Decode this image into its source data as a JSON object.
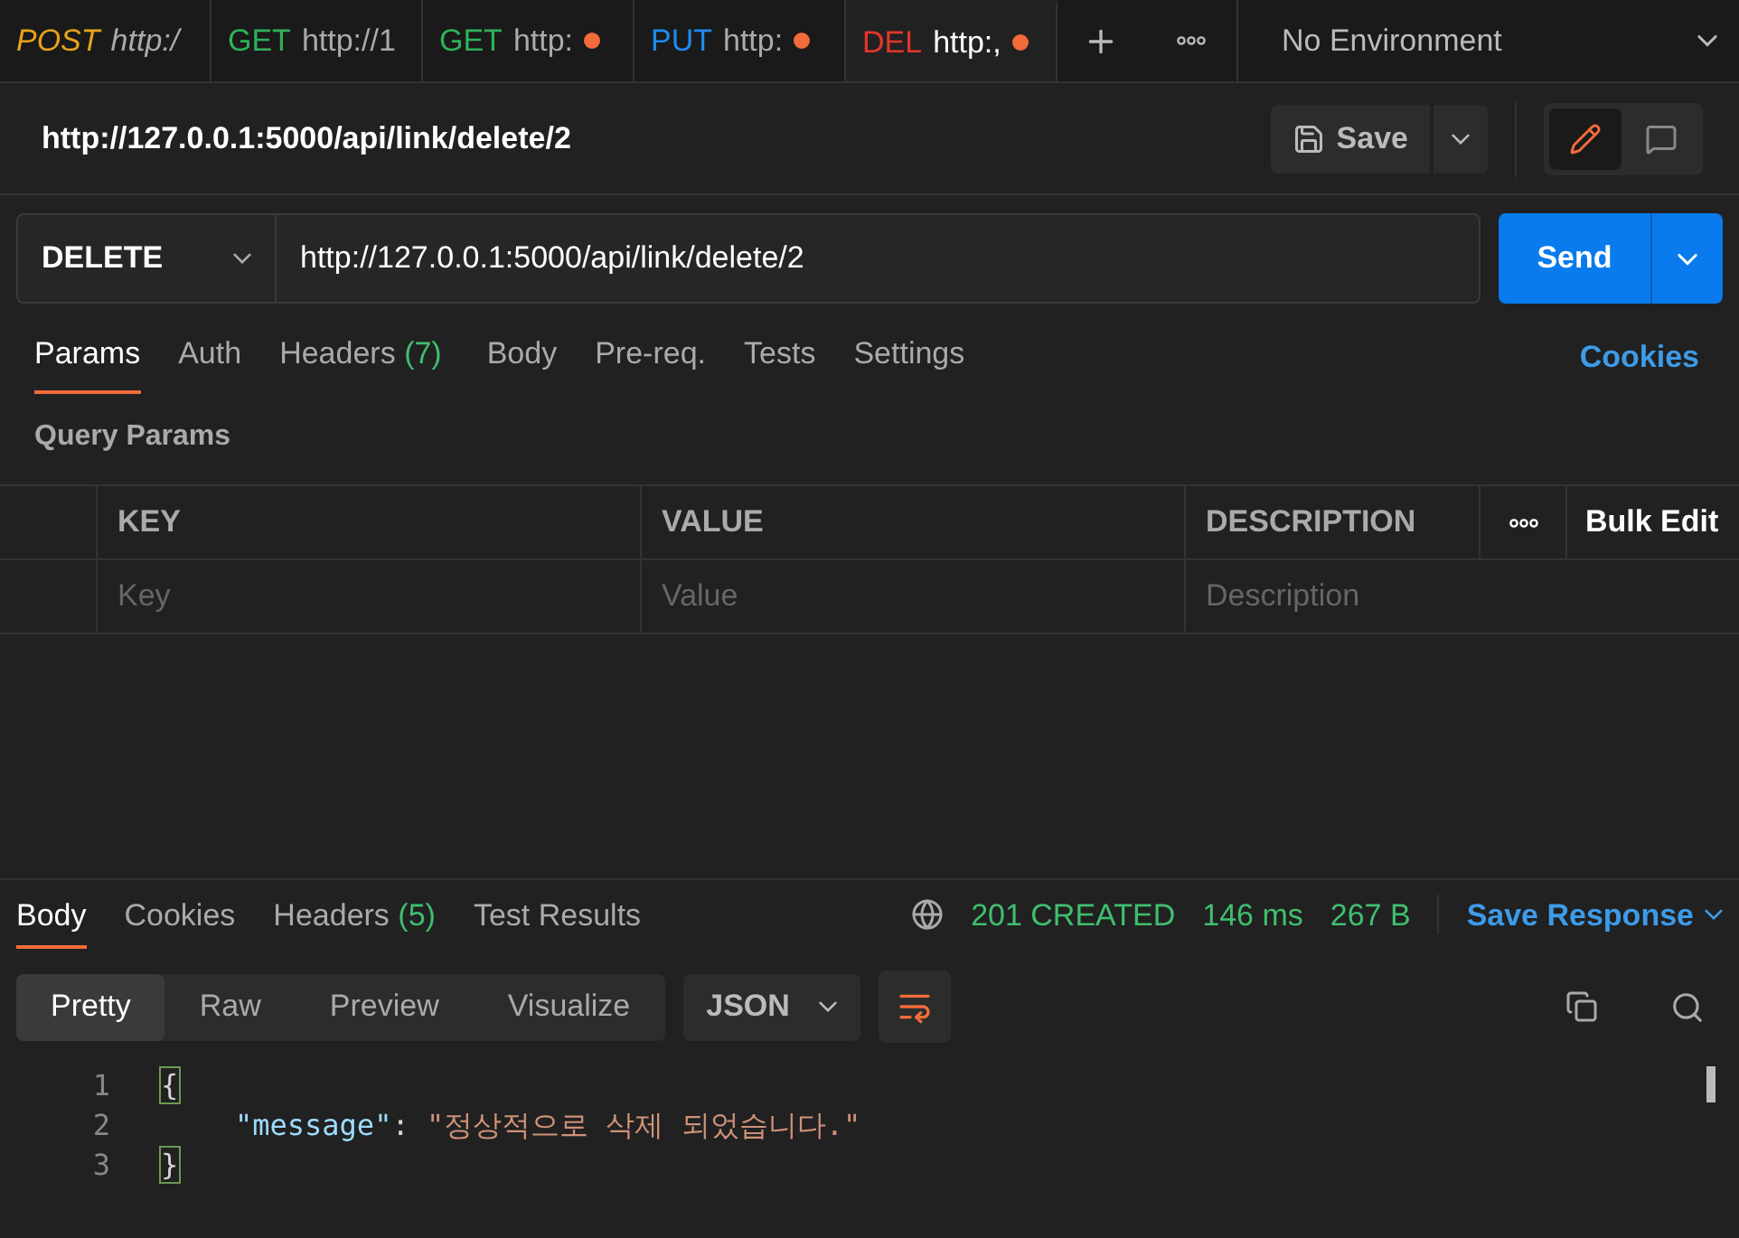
{
  "tabs": [
    {
      "method": "POST",
      "color": "#e8a317",
      "url": "http:/",
      "unsaved": false,
      "preview": true,
      "selected": false
    },
    {
      "method": "GET",
      "color": "#2fb15a",
      "url": "http://1",
      "unsaved": false,
      "preview": false,
      "selected": false
    },
    {
      "method": "GET",
      "color": "#2fb15a",
      "url": "http:",
      "unsaved": true,
      "preview": false,
      "selected": false
    },
    {
      "method": "PUT",
      "color": "#1d8cf0",
      "url": "http:",
      "unsaved": true,
      "preview": false,
      "selected": false
    },
    {
      "method": "DEL",
      "color": "#e5362b",
      "url": "http:,",
      "unsaved": true,
      "preview": false,
      "selected": true
    }
  ],
  "environment": "No Environment",
  "request_title": "http://127.0.0.1:5000/api/link/delete/2",
  "save_button": "Save",
  "mode_toggle": [
    {
      "kind": "edit",
      "selected": true
    },
    {
      "kind": "comment",
      "selected": false
    }
  ],
  "method": "DELETE",
  "url": "http://127.0.0.1:5000/api/link/delete/2",
  "send_button": "Send",
  "request_tabs": [
    {
      "label": "Params",
      "selected": true
    },
    {
      "label": "Auth",
      "selected": false
    },
    {
      "label": "Headers",
      "count": "(7)",
      "selected": false
    },
    {
      "label": "Body",
      "selected": false
    },
    {
      "label": "Pre-req.",
      "selected": false
    },
    {
      "label": "Tests",
      "selected": false
    },
    {
      "label": "Settings",
      "selected": false
    }
  ],
  "cookies_link": "Cookies",
  "query_params": {
    "title": "Query Params",
    "columns": [
      "KEY",
      "VALUE",
      "DESCRIPTION"
    ],
    "bulk_edit": "Bulk Edit",
    "placeholders": [
      "Key",
      "Value",
      "Description"
    ]
  },
  "response_tabs": [
    {
      "label": "Body",
      "selected": true
    },
    {
      "label": "Cookies",
      "selected": false
    },
    {
      "label": "Headers",
      "count": "(5)",
      "selected": false
    },
    {
      "label": "Test Results",
      "selected": false
    }
  ],
  "status": "201 CREATED",
  "time": "146 ms",
  "size": "267 B",
  "save_response": "Save Response",
  "view_modes": [
    {
      "label": "Pretty",
      "selected": true
    },
    {
      "label": "Raw",
      "selected": false
    },
    {
      "label": "Preview",
      "selected": false
    },
    {
      "label": "Visualize",
      "selected": false
    }
  ],
  "format": "JSON",
  "code_lines": [
    {
      "number": "1",
      "tokens": [
        {
          "kind": "brace",
          "text": "{"
        }
      ]
    },
    {
      "number": "2",
      "tokens": [
        {
          "kind": "key",
          "text": "\"message\""
        },
        {
          "kind": "punct",
          "text": ": "
        },
        {
          "kind": "string",
          "text": "\"정상적으로 삭제 되었습니다.\""
        }
      ]
    },
    {
      "number": "3",
      "tokens": [
        {
          "kind": "brace",
          "text": "}"
        }
      ]
    }
  ]
}
